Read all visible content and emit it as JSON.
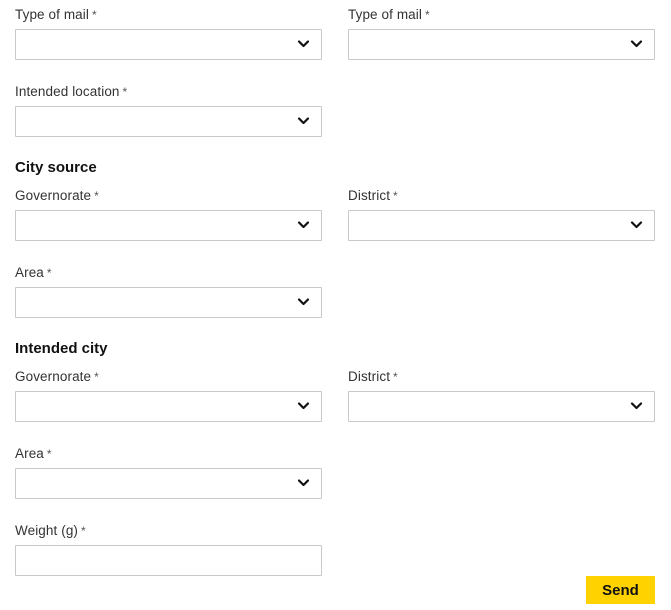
{
  "form": {
    "required_marker": "*",
    "mail_type_left": {
      "label": "Type of mail",
      "value": ""
    },
    "mail_type_right": {
      "label": "Type of mail",
      "value": ""
    },
    "intended_location": {
      "label": "Intended location",
      "value": ""
    },
    "city_source": {
      "heading": "City source",
      "governorate": {
        "label": "Governorate",
        "value": ""
      },
      "district": {
        "label": "District",
        "value": ""
      },
      "area": {
        "label": "Area",
        "value": ""
      }
    },
    "intended_city": {
      "heading": "Intended city",
      "governorate": {
        "label": "Governorate",
        "value": ""
      },
      "district": {
        "label": "District",
        "value": ""
      },
      "area": {
        "label": "Area",
        "value": ""
      }
    },
    "weight": {
      "label": "Weight (g)",
      "value": ""
    },
    "send_label": "Send"
  },
  "colors": {
    "accent": "#ffd200",
    "border": "#c9c9c9"
  },
  "icons": {
    "dropdown": "chevron-down-icon"
  }
}
